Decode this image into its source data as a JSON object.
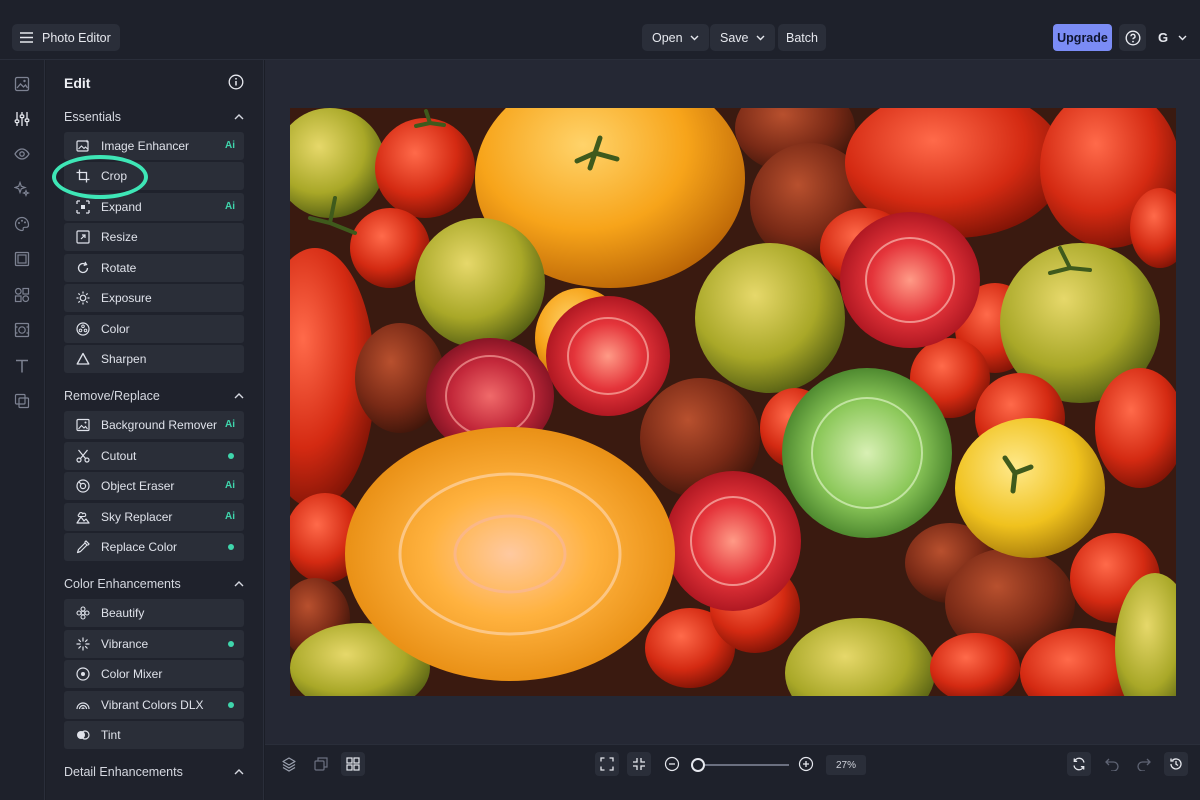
{
  "app": {
    "title": "Photo Editor"
  },
  "topbar": {
    "open_label": "Open",
    "save_label": "Save",
    "batch_label": "Batch",
    "upgrade_label": "Upgrade",
    "user_initial": "G"
  },
  "rail": {
    "icons": [
      "image-icon",
      "sliders-icon",
      "eye-icon",
      "sparkles-icon",
      "palette-icon",
      "frame-icon",
      "shapes-icon",
      "texture-icon",
      "text-icon",
      "overlay-icon"
    ],
    "active": "sliders-icon"
  },
  "panel": {
    "title": "Edit",
    "sections": [
      {
        "title": "Essentials",
        "items": [
          {
            "label": "Image Enhancer",
            "badge": "Ai",
            "icon": "image-enhance-icon"
          },
          {
            "label": "Crop",
            "badge": "",
            "icon": "crop-icon",
            "highlighted": true
          },
          {
            "label": "Expand",
            "badge": "Ai",
            "icon": "expand-icon"
          },
          {
            "label": "Resize",
            "badge": "",
            "icon": "resize-icon"
          },
          {
            "label": "Rotate",
            "badge": "",
            "icon": "rotate-icon"
          },
          {
            "label": "Exposure",
            "badge": "",
            "icon": "sun-icon"
          },
          {
            "label": "Color",
            "badge": "",
            "icon": "color-icon"
          },
          {
            "label": "Sharpen",
            "badge": "",
            "icon": "triangle-icon"
          }
        ]
      },
      {
        "title": "Remove/Replace",
        "items": [
          {
            "label": "Background Remover",
            "badge": "Ai",
            "icon": "image-icon"
          },
          {
            "label": "Cutout",
            "badge": "dot",
            "icon": "scissors-icon"
          },
          {
            "label": "Object Eraser",
            "badge": "Ai",
            "icon": "eraser-icon"
          },
          {
            "label": "Sky Replacer",
            "badge": "Ai",
            "icon": "sky-icon"
          },
          {
            "label": "Replace Color",
            "badge": "dot",
            "icon": "dropper-icon"
          }
        ]
      },
      {
        "title": "Color Enhancements",
        "items": [
          {
            "label": "Beautify",
            "badge": "",
            "icon": "flower-icon"
          },
          {
            "label": "Vibrance",
            "badge": "dot",
            "icon": "sparkle-icon"
          },
          {
            "label": "Color Mixer",
            "badge": "",
            "icon": "mixer-icon"
          },
          {
            "label": "Vibrant Colors DLX",
            "badge": "dot",
            "icon": "rainbow-icon"
          },
          {
            "label": "Tint",
            "badge": "",
            "icon": "tint-icon"
          }
        ]
      },
      {
        "title": "Detail Enhancements",
        "items": []
      }
    ]
  },
  "badges": {
    "ai_text": "Ai"
  },
  "zoom": {
    "value": "27%",
    "level": 0.27
  },
  "colors": {
    "accent": "#7b8cf5",
    "ai_green": "#3fd6ac",
    "highlight_ring": "#3ee6b6",
    "background": "#1b1e27"
  }
}
